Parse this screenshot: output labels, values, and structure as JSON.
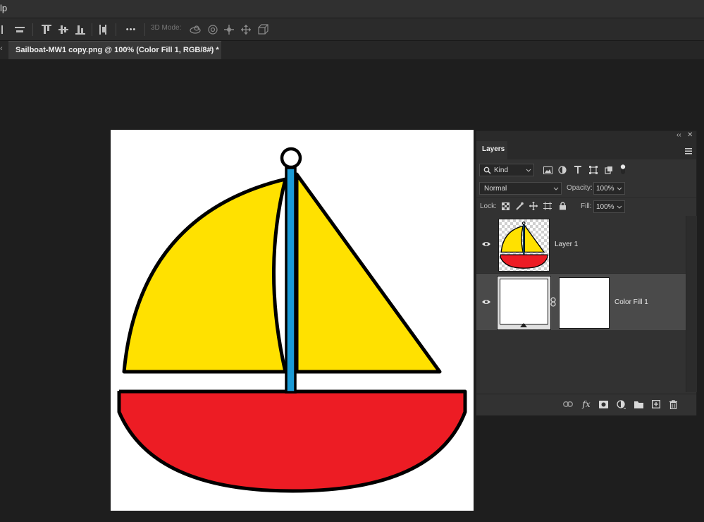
{
  "menubar": {
    "fragment": "lp"
  },
  "options_bar": {
    "more_label": "•••",
    "mode_label": "3D Mode:",
    "icons": [
      "align-left-edge-icon",
      "align-top-edge-icon",
      "align-vertical-center-icon",
      "align-bottom-edge-icon",
      "distribute-icon",
      "orbit-3d-icon",
      "roll-3d-icon",
      "pan-3d-icon",
      "slide-3d-icon",
      "scale-3d-icon"
    ]
  },
  "document_tab": {
    "title": "Sailboat-MW1 copy.png @ 100% (Color Fill 1, RGB/8#) *",
    "close": "×",
    "scroll_left": "‹"
  },
  "canvas": {
    "colors": {
      "sail": "#FFE100",
      "hull": "#ED1C24",
      "mast": "#1A9AD6",
      "outline": "#000000",
      "background": "#FFFFFF"
    }
  },
  "layers_panel": {
    "collapse": "‹‹",
    "close": "✕",
    "tab_label": "Layers",
    "filter": {
      "value": "Kind"
    },
    "blend_mode": {
      "value": "Normal"
    },
    "opacity": {
      "label": "Opacity:",
      "value": "100%"
    },
    "lock": {
      "label": "Lock:"
    },
    "fill": {
      "label": "Fill:",
      "value": "100%"
    },
    "layers": [
      {
        "name": "Layer 1",
        "visible": true,
        "selected": false
      },
      {
        "name": "Color Fill 1",
        "visible": true,
        "selected": true
      }
    ],
    "footer_icons": [
      "link-layers-icon",
      "fx-icon",
      "add-mask-icon",
      "adjustment-layer-icon",
      "new-group-icon",
      "new-layer-icon",
      "delete-layer-icon"
    ],
    "fx_label": "fx"
  },
  "colors": {
    "app_bg": "#1E1E1E",
    "panel_bg": "#323232",
    "selected_row": "#4A4A4A",
    "accent_text": "#F0F0F0"
  }
}
